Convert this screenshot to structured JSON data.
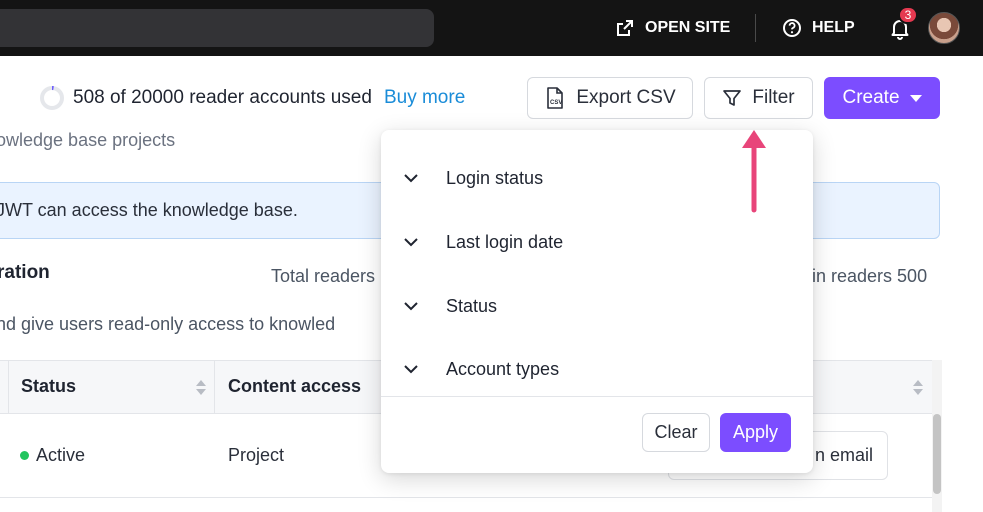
{
  "topbar": {
    "open_site_label": "OPEN SITE",
    "help_label": "HELP",
    "notification_count": "3"
  },
  "header": {
    "usage_text": "508 of 20000 reader accounts used",
    "usage_fraction": 0.0254,
    "buy_more_label": "Buy more",
    "export_label": "Export CSV",
    "filter_label": "Filter",
    "create_label": "Create"
  },
  "page": {
    "subtitle": "owledge base projects",
    "info_text": "JWT can access the knowledge base.",
    "section_title": "ration",
    "total_readers_text": "Total readers",
    "readers_right_text": "in readers 500",
    "section_desc": "nd give users read-only access to knowled"
  },
  "table": {
    "columns": [
      "Status",
      "Content access"
    ],
    "rows": [
      {
        "status": "Active",
        "content_access": "Project",
        "action": "n email"
      }
    ]
  },
  "filter_dropdown": {
    "items": [
      "Login status",
      "Last login date",
      "Status",
      "Account types"
    ],
    "clear_label": "Clear",
    "apply_label": "Apply"
  },
  "colors": {
    "accent": "#7c4dff",
    "link": "#1a8cd8",
    "status_active": "#22c55e",
    "annotation_arrow": "#e8457a",
    "badge": "#e53950"
  }
}
